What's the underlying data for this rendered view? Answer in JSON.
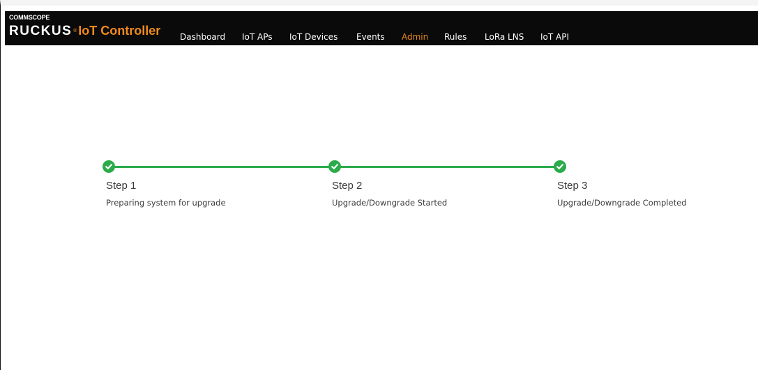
{
  "header": {
    "vendor": "COMMSCOPE",
    "brand": "RUCKUS",
    "product": "IoT Controller",
    "nav": [
      {
        "label": "Dashboard",
        "active": false
      },
      {
        "label": "IoT APs",
        "active": false
      },
      {
        "label": "IoT Devices",
        "active": false
      },
      {
        "label": "Events",
        "active": false
      },
      {
        "label": "Admin",
        "active": true
      },
      {
        "label": "Rules",
        "active": false
      },
      {
        "label": "LoRa LNS",
        "active": false
      },
      {
        "label": "IoT API",
        "active": false
      }
    ]
  },
  "upgrade": {
    "steps": [
      {
        "title": "Step 1",
        "description": "Preparing system for upgrade",
        "status": "complete",
        "icon": "check-circle-icon"
      },
      {
        "title": "Step 2",
        "description": "Upgrade/Downgrade Started",
        "status": "complete",
        "icon": "check-circle-icon"
      },
      {
        "title": "Step 3",
        "description": "Upgrade/Downgrade Completed",
        "status": "complete",
        "icon": "check-circle-icon"
      }
    ]
  },
  "colors": {
    "navbar_bg": "#0a0a0a",
    "accent_orange": "#e8891f",
    "success_green": "#2bab4a",
    "text": "#3a3a3a"
  }
}
